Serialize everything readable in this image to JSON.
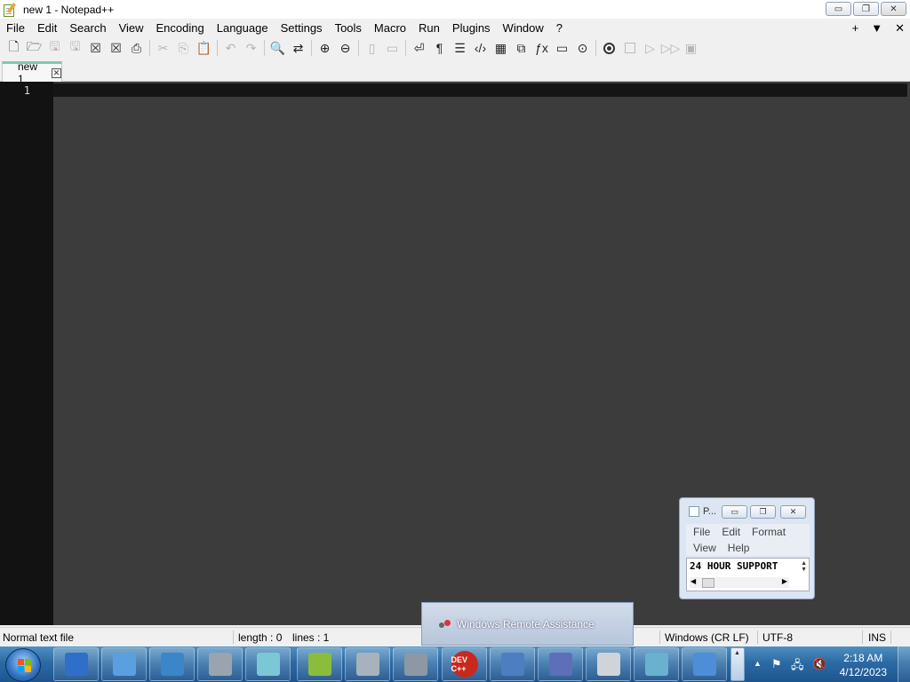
{
  "window": {
    "title": "new 1 - Notepad++",
    "buttons": {
      "minimize": "▭",
      "restore": "❐",
      "close": "✕"
    }
  },
  "menu": {
    "items": [
      "File",
      "Edit",
      "Search",
      "View",
      "Encoding",
      "Language",
      "Settings",
      "Tools",
      "Macro",
      "Run",
      "Plugins",
      "Window",
      "?"
    ],
    "right": [
      "+",
      "▼",
      "✕"
    ]
  },
  "toolbar": {
    "icons": [
      "new-file-icon",
      "open-file-icon",
      "save-icon",
      "save-all-icon",
      "close-icon",
      "close-all-icon",
      "print-icon",
      "cut-icon",
      "copy-icon",
      "paste-icon",
      "undo-icon",
      "redo-icon",
      "find-icon",
      "replace-icon",
      "zoom-in-icon",
      "zoom-out-icon",
      "sync-vertical-icon",
      "sync-horizontal-icon",
      "word-wrap-icon",
      "show-all-chars-icon",
      "indent-guide-icon",
      "xml-tag-icon",
      "document-map-icon",
      "clone-icon",
      "function-list-icon",
      "monitor-icon",
      "folder-as-workspace-icon",
      "record-macro-icon",
      "stop-macro-icon",
      "play-macro-icon",
      "run-macro-multiple-icon",
      "save-macro-icon"
    ],
    "glyphs": [
      "🗋",
      "🗁",
      "🖫",
      "🖫",
      "☒",
      "☒",
      "⎙",
      "✂",
      "⎘",
      "📋",
      "↶",
      "↷",
      "🔍",
      "⇄",
      "⊕",
      "⊖",
      "▯",
      "▭",
      "⏎",
      "¶",
      "☰",
      "‹/›",
      "▦",
      "⧉",
      "ƒx",
      "▭",
      "⊙",
      "●",
      "■",
      "▷",
      "▷▷",
      "▣"
    ]
  },
  "tabs": [
    {
      "label": "new 1",
      "close": "✕"
    }
  ],
  "editor": {
    "line_numbers": [
      "1"
    ],
    "background": "#3c3c3c",
    "gutter_background": "#121212"
  },
  "statusbar": {
    "file_type": "Normal text file",
    "length": "length : 0",
    "lines": "lines : 1",
    "eol": "Windows (CR LF)",
    "encoding": "UTF-8",
    "mode": "INS"
  },
  "mini_notepad": {
    "title": "P...",
    "menu": [
      "File",
      "Edit",
      "Format",
      "View",
      "Help"
    ],
    "text": "24 HOUR SUPPORT",
    "buttons": {
      "minimize": "▭",
      "restore": "❐",
      "close": "✕"
    }
  },
  "remote_assistance": {
    "label": "Windows Remote Assistance"
  },
  "taskbar": {
    "apps": [
      {
        "name": "remote-desktop-app",
        "color": "#2f6fc8",
        "label": ""
      },
      {
        "name": "paper-plane-app",
        "color": "#5aa0e0",
        "label": ""
      },
      {
        "name": "photo-viewer-app",
        "color": "#3a86c9",
        "label": ""
      },
      {
        "name": "fax-app",
        "color": "#9aa4ae",
        "label": ""
      },
      {
        "name": "notepad-app",
        "color": "#7cc7d6",
        "label": ""
      },
      {
        "name": "notepad-plus-plus-app",
        "color": "#8bbd3c",
        "label": ""
      },
      {
        "name": "speaker-app",
        "color": "#a8b2bc",
        "label": ""
      },
      {
        "name": "projector-app",
        "color": "#8d98a4",
        "label": ""
      },
      {
        "name": "dev-cpp-app",
        "color": "#c8281e",
        "label": "DEV C++"
      },
      {
        "name": "wordpad-app",
        "color": "#4b7fc1",
        "label": ""
      },
      {
        "name": "compass-app",
        "color": "#5d6fb8",
        "label": ""
      },
      {
        "name": "mouse-app",
        "color": "#cfd4d9",
        "label": ""
      },
      {
        "name": "document-app",
        "color": "#6ab0cf",
        "label": ""
      },
      {
        "name": "control-panel-app",
        "color": "#4d8ed6",
        "label": ""
      }
    ],
    "clock_time": "2:18 AM",
    "clock_date": "4/12/2023",
    "tray_icons": [
      "▲",
      "⚑",
      "🖧",
      "🔇"
    ]
  }
}
